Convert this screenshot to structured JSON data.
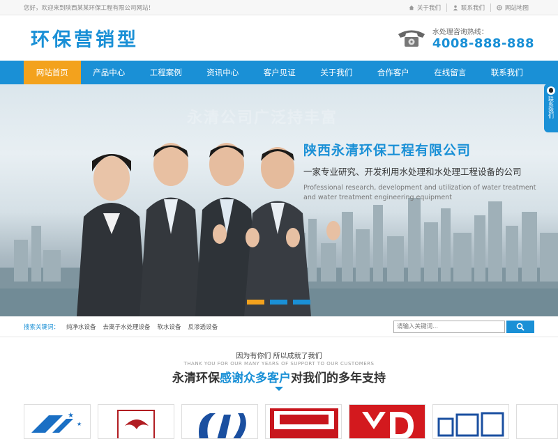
{
  "topbar": {
    "welcome": "您好，欢迎来到陕西某某环保工程有限公司网站！",
    "links": [
      {
        "label": "关于我们",
        "icon": "home-icon"
      },
      {
        "label": "联系我们",
        "icon": "user-icon"
      },
      {
        "label": "网站地图",
        "icon": "globe-icon"
      }
    ]
  },
  "header": {
    "logo": "环保营销型",
    "hotline_label": "水处理咨询热线：",
    "hotline_number": "4008-888-888"
  },
  "nav": {
    "items": [
      "网站首页",
      "产品中心",
      "工程案例",
      "资讯中心",
      "客户见证",
      "关于我们",
      "合作客户",
      "在线留言",
      "联系我们"
    ]
  },
  "banner": {
    "ghost": "永清公司广泛持丰富",
    "title": "陕西永清环保工程有限公司",
    "subtitle": "一家专业研究、开发利用水处理和水处理工程设备的公司",
    "english": "Professional research, development and utilization of water treatment and water treatment engineering equipment"
  },
  "side_qq": {
    "label": "联系我们"
  },
  "search": {
    "keywords_label": "搜索关键词：",
    "keywords": [
      "纯净水设备",
      "去离子水处理设备",
      "软水设备",
      "反渗透设备"
    ],
    "placeholder": "请输入关键词..."
  },
  "thanks": {
    "line1": "因为有你们  所以成就了我们",
    "line2": "THANK YOU FOR OUR MANY YEARS OF SUPPORT TO OUR CUSTOMERS",
    "line3_pre": "永清环保",
    "line3_hl": "感谢众多客户",
    "line3_post": "对我们的多年支持"
  },
  "colors": {
    "brand": "#1a90d6",
    "accent": "#f3a21d"
  }
}
